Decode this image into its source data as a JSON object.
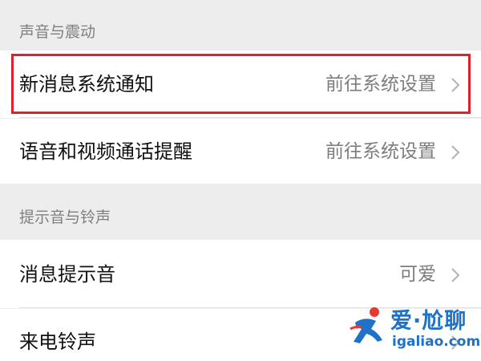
{
  "sections": [
    {
      "header": "声音与震动",
      "rows": [
        {
          "label": "新消息系统通知",
          "value": "前往系统设置",
          "icon": "chevron-right-icon"
        },
        {
          "label": "语音和视频通话提醒",
          "value": "前往系统设置",
          "icon": "chevron-right-icon"
        }
      ]
    },
    {
      "header": "提示音与铃声",
      "rows": [
        {
          "label": "消息提示音",
          "value": "可爱",
          "icon": "chevron-right-icon"
        },
        {
          "label": "来电铃声",
          "icon": "chevron-right-icon"
        }
      ]
    }
  ],
  "highlight": {
    "target": "新消息系统通知",
    "color": "#e0202a"
  },
  "watermark": {
    "title": "爱·尬聊",
    "url": "igaliao.com",
    "color": "#1e72c8",
    "logo_colors": [
      "#e63a2e",
      "#1e72c8"
    ]
  },
  "colors": {
    "background": "#ededed",
    "row_background": "#ffffff",
    "header_text": "#7f7f7f",
    "value_text": "#7d7d7d"
  }
}
